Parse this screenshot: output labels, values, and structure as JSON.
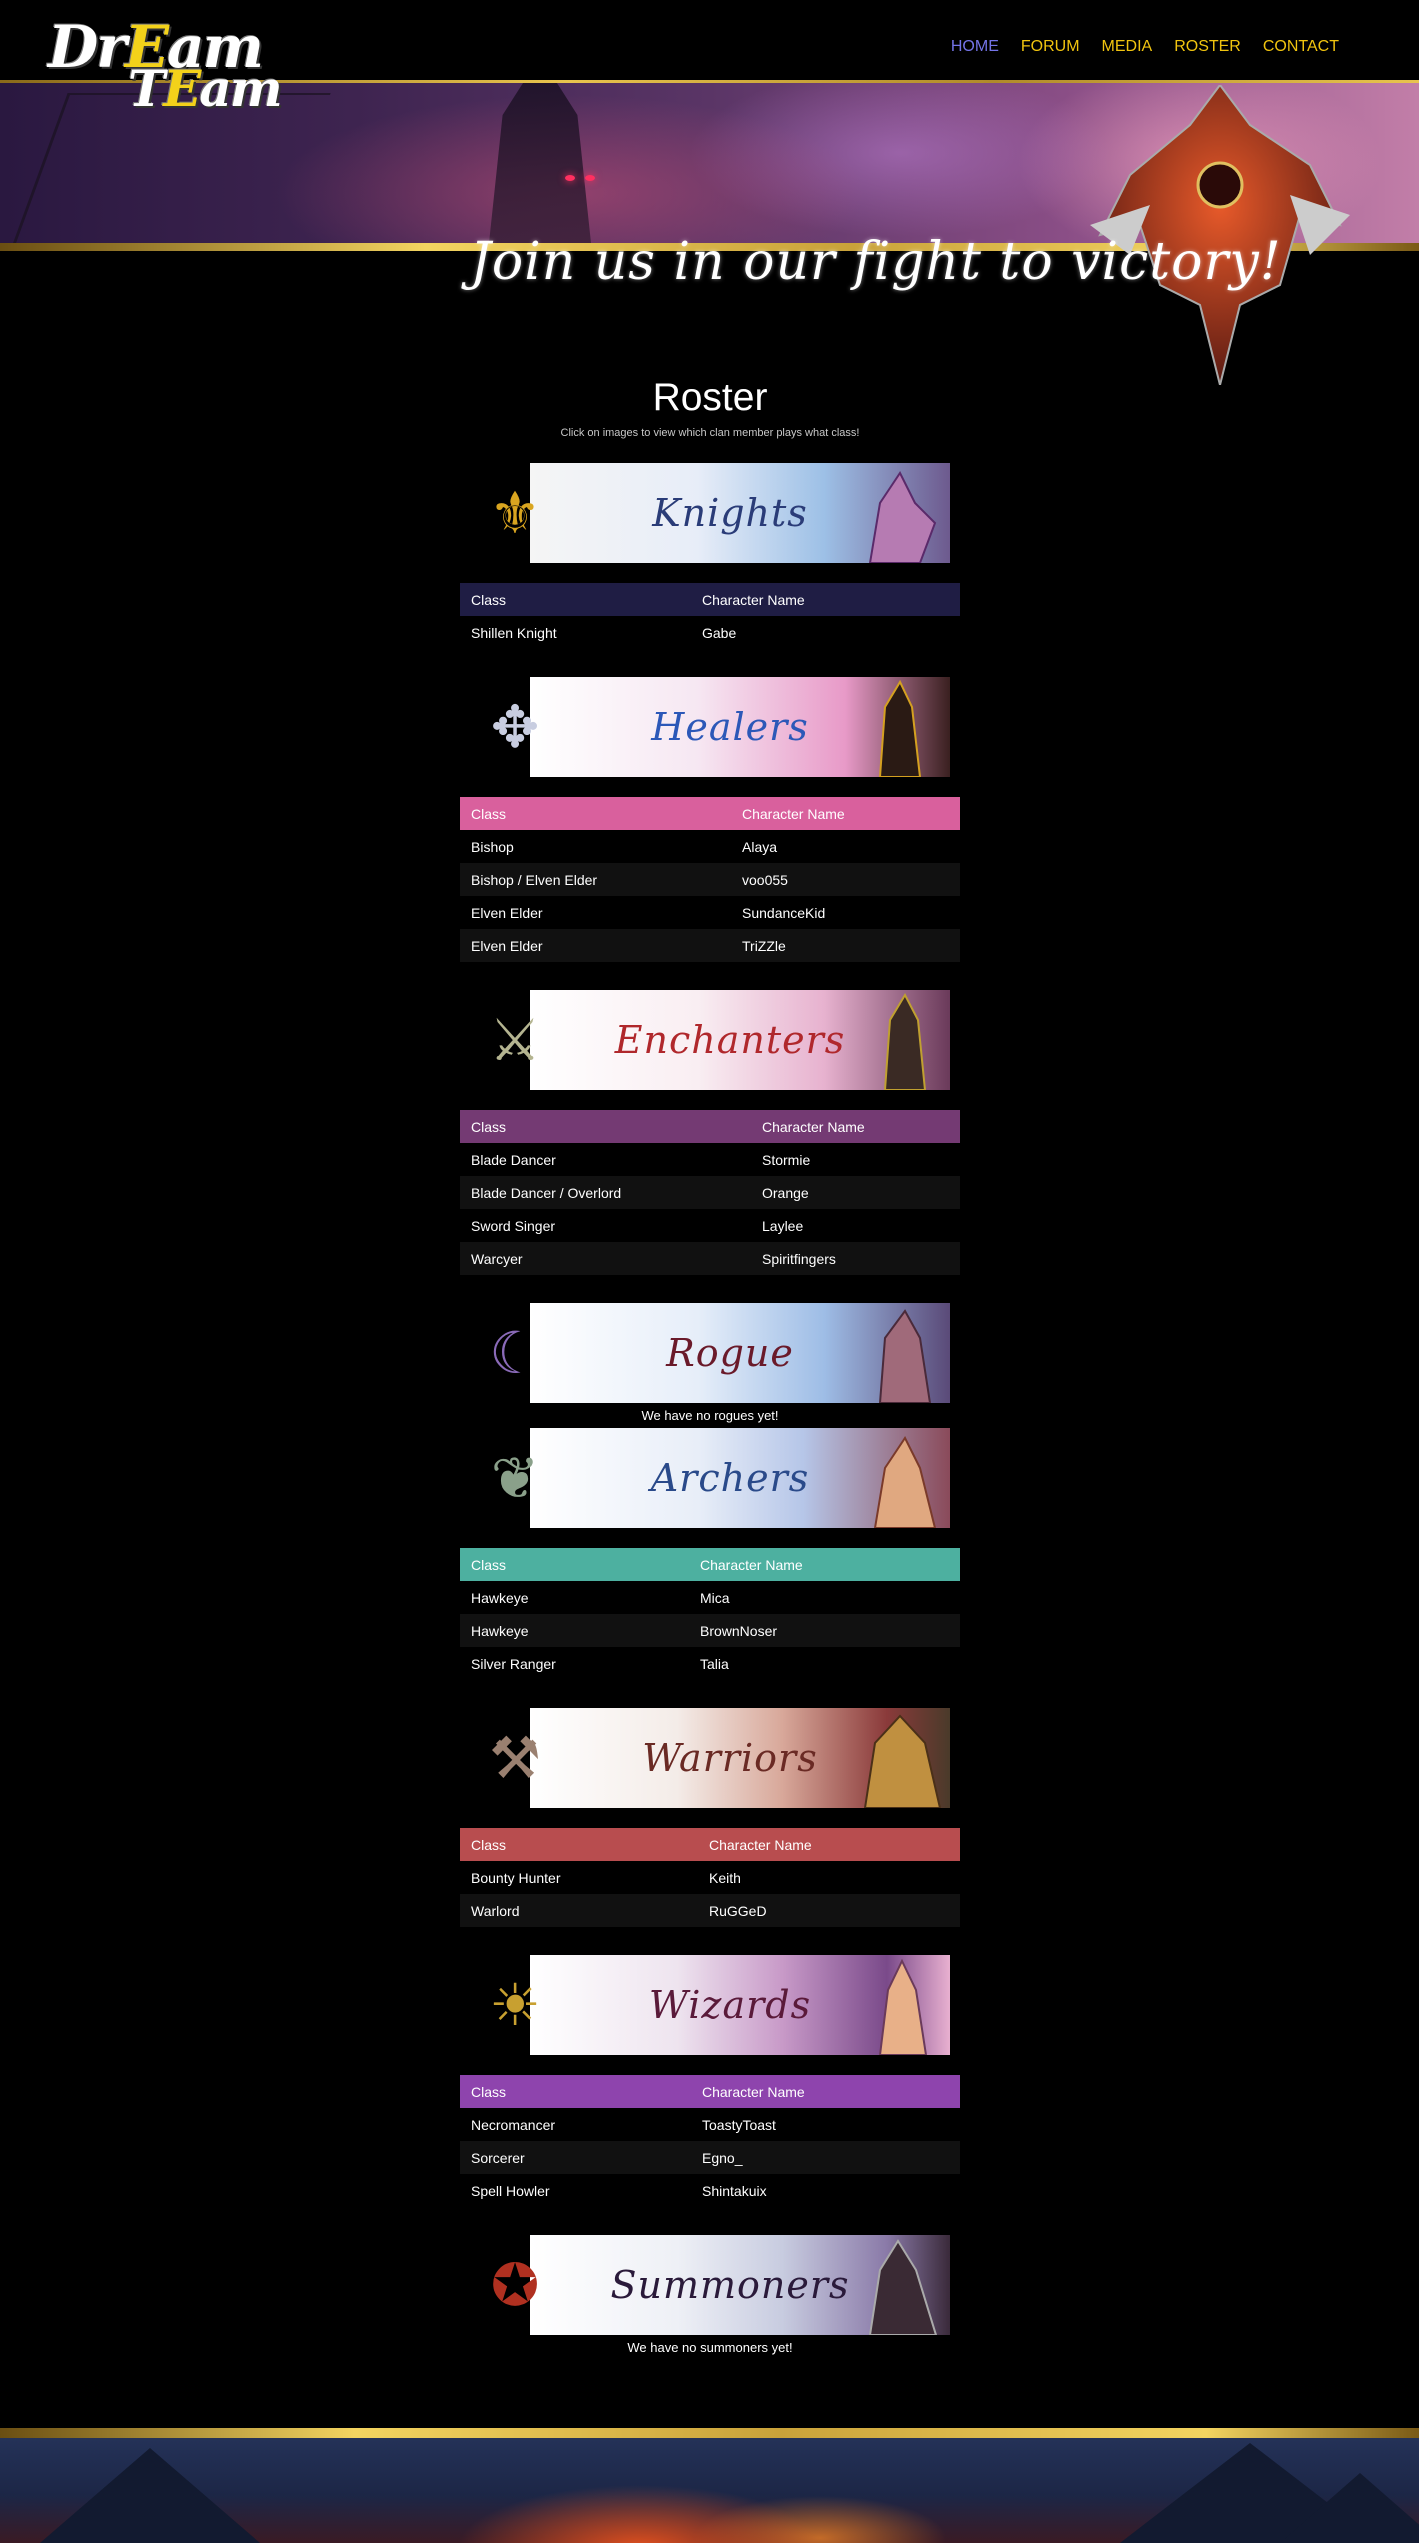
{
  "site": {
    "logo_line1_a": "Dr",
    "logo_line1_b": "E",
    "logo_line1_c": "am",
    "logo_line2_a": "T",
    "logo_line2_b": "E",
    "logo_line2_c": "am",
    "tagline": "Join us in our fight to victory!"
  },
  "nav": {
    "items": [
      {
        "label": "HOME",
        "active": true
      },
      {
        "label": "FORUM"
      },
      {
        "label": "MEDIA"
      },
      {
        "label": "ROSTER"
      },
      {
        "label": "CONTACT"
      }
    ]
  },
  "page": {
    "title": "Roster",
    "subtitle": "Click on images to view which clan member plays what class!"
  },
  "sections": [
    {
      "name": "Knights",
      "color": "#1f1d44",
      "col_class": "Class",
      "col_name": "Character Name",
      "rows": [
        [
          "Shillen Knight",
          "Gabe"
        ]
      ]
    },
    {
      "name": "Healers",
      "color": "#d9609d",
      "col_class": "Class",
      "col_name": "Character Name",
      "rows": [
        [
          "Bishop",
          "Alaya"
        ],
        [
          "Bishop / Elven Elder",
          "voo055"
        ],
        [
          "Elven Elder",
          "SundanceKid"
        ],
        [
          "Elven Elder",
          "TriZZle"
        ]
      ]
    },
    {
      "name": "Enchanters",
      "color": "#743a73",
      "col_class": "Class",
      "col_name": "Character Name",
      "rows": [
        [
          "Blade Dancer",
          "Stormie"
        ],
        [
          "Blade Dancer / Overlord",
          "Orange"
        ],
        [
          "Sword Singer",
          "Laylee"
        ],
        [
          "Warcyer",
          "Spiritfingers"
        ]
      ]
    },
    {
      "name": "Rogue",
      "empty_note": "We have no rogues yet!"
    },
    {
      "name": "Archers",
      "color": "#4db0a0",
      "col_class": "Class",
      "col_name": "Character Name",
      "rows": [
        [
          "Hawkeye",
          "Mica"
        ],
        [
          "Hawkeye",
          "BrownNoser"
        ],
        [
          "Silver Ranger",
          "Talia"
        ]
      ]
    },
    {
      "name": "Warriors",
      "color": "#b84d4f",
      "col_class": "Class",
      "col_name": "Character Name",
      "rows": [
        [
          "Bounty Hunter",
          "Keith"
        ],
        [
          "Warlord",
          "RuGGeD"
        ]
      ]
    },
    {
      "name": "Wizards",
      "color": "#8e44ad",
      "col_class": "Class",
      "col_name": "Character Name",
      "rows": [
        [
          "Necromancer",
          "ToastyToast"
        ],
        [
          "Sorcerer",
          "Egno_"
        ],
        [
          "Spell Howler",
          "Shintakuix"
        ]
      ]
    },
    {
      "name": "Summoners",
      "empty_note": "We have no summoners yet!"
    }
  ]
}
